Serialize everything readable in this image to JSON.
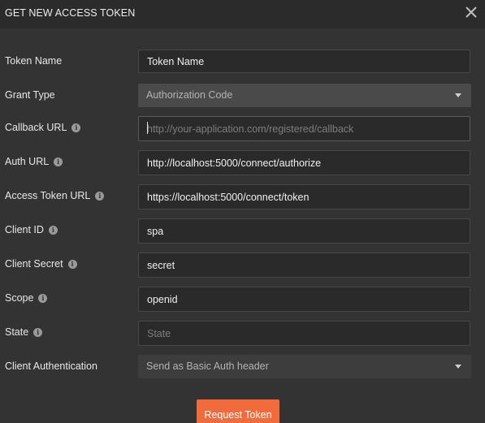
{
  "dialog": {
    "title": "GET NEW ACCESS TOKEN",
    "close_icon": "close-icon"
  },
  "fields": {
    "token_name": {
      "label": "Token Name",
      "value": "Token Name",
      "placeholder": ""
    },
    "grant_type": {
      "label": "Grant Type",
      "value": "Authorization Code"
    },
    "callback_url": {
      "label": "Callback URL",
      "value": "",
      "placeholder": "http://your-application.com/registered/callback"
    },
    "auth_url": {
      "label": "Auth URL",
      "value": "http://localhost:5000/connect/authorize"
    },
    "access_token_url": {
      "label": "Access Token URL",
      "value": "https://localhost:5000/connect/token"
    },
    "client_id": {
      "label": "Client ID",
      "value": "spa"
    },
    "client_secret": {
      "label": "Client Secret",
      "value": "secret"
    },
    "scope": {
      "label": "Scope",
      "value": "openid"
    },
    "state": {
      "label": "State",
      "value": "",
      "placeholder": "State"
    },
    "client_authentication": {
      "label": "Client Authentication",
      "value": "Send as Basic Auth header"
    }
  },
  "info_icon_glyph": "i",
  "actions": {
    "request_token_label": "Request Token"
  },
  "colors": {
    "background": "#333333",
    "header": "#2b2b2b",
    "accent": "#f26b3a",
    "input_bg": "#2a2a2a"
  }
}
